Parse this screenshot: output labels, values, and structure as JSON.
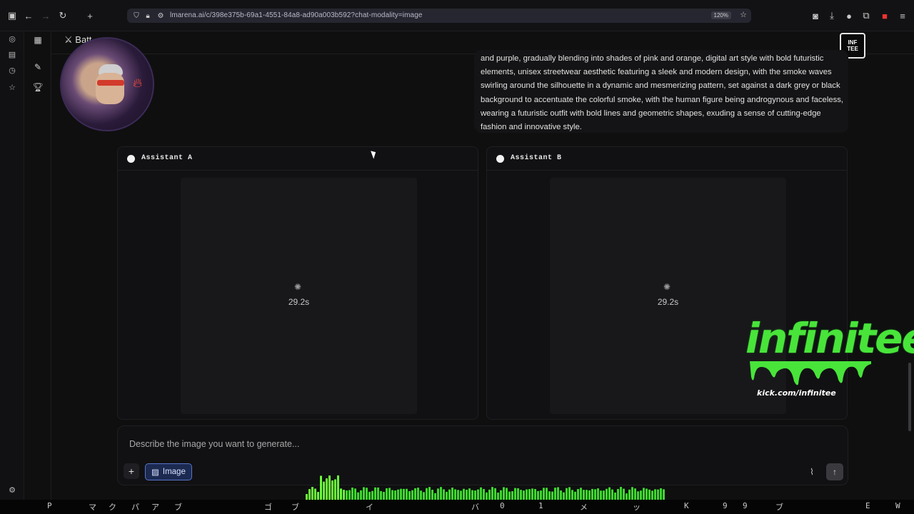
{
  "browser": {
    "url": "lmarena.ai/c/398e375b-69a1-4551-84a8-ad90a003b592?chat-modality=image",
    "zoom": "120%"
  },
  "header": {
    "title": "Batt"
  },
  "prompt": {
    "text": "and purple, gradually blending into shades of pink and orange, digital art style with bold futuristic elements, unisex streetwear aesthetic featuring a sleek and modern design, with the smoke waves swirling around the silhouette in a dynamic and mesmerizing pattern, set against a dark grey or black background to accentuate the colorful smoke, with the human figure being androgynous and faceless, wearing a futuristic outfit with bold lines and geometric shapes, exuding a sense of cutting-edge fashion and innovative style."
  },
  "assistants": [
    {
      "label": "Assistant A",
      "timer": "29.2s"
    },
    {
      "label": "Assistant B",
      "timer": "29.2s"
    }
  ],
  "composer": {
    "placeholder": "Describe the image you want to generate...",
    "image_label": "Image"
  },
  "overlay": {
    "brand": "infinitee",
    "brand_url": "kick.com/infinitee"
  },
  "matrix_glyphs": [
    "P",
    "マ",
    "ク",
    "パ",
    "ア",
    "ブ",
    "ゴ",
    "ブ",
    "イ",
    "バ",
    "0",
    "1",
    "メ",
    "ッ",
    "K",
    "9",
    "9",
    "ブ",
    "E",
    "W"
  ],
  "colors": {
    "accent": "#5774c9",
    "brand_green": "#48e43a"
  }
}
